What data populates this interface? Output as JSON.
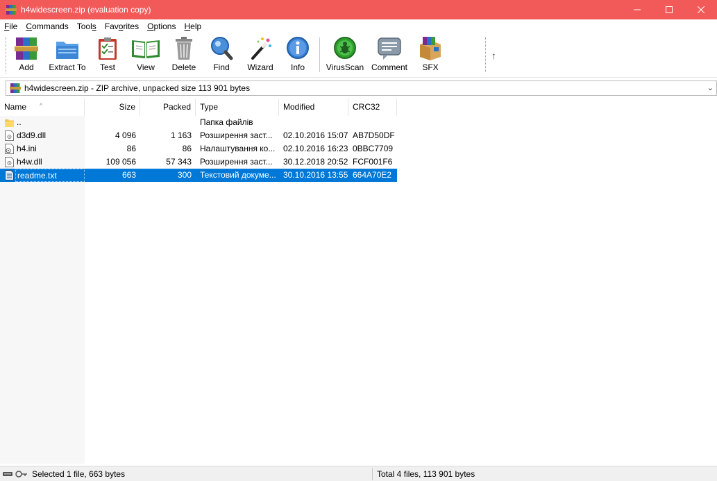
{
  "window": {
    "title": "h4widescreen.zip (evaluation copy)",
    "controls": {
      "minimize": "—",
      "maximize": "☐",
      "close": "✕"
    }
  },
  "menu": [
    {
      "label": "File",
      "u": "F",
      "rest": "ile"
    },
    {
      "label": "Commands",
      "u": "C",
      "rest": "ommands"
    },
    {
      "label": "Tools",
      "pre": "Tool",
      "u": "s"
    },
    {
      "label": "Favorites",
      "pre": "Fav",
      "u": "o",
      "rest": "rites"
    },
    {
      "label": "Options",
      "u": "O",
      "rest": "ptions"
    },
    {
      "label": "Help",
      "u": "H",
      "rest": "elp"
    }
  ],
  "toolbar": {
    "add": "Add",
    "extract": "Extract To",
    "test": "Test",
    "view": "View",
    "delete": "Delete",
    "find": "Find",
    "wizard": "Wizard",
    "info": "Info",
    "virusscan": "VirusScan",
    "comment": "Comment",
    "sfx": "SFX",
    "up_arrow": "↑"
  },
  "address": {
    "text": "h4widescreen.zip - ZIP archive, unpacked size 113 901 bytes",
    "dropdown": "⌄"
  },
  "columns": {
    "name": "Name",
    "size": "Size",
    "packed": "Packed",
    "type": "Type",
    "modified": "Modified",
    "crc": "CRC32",
    "sort_arrow": "^"
  },
  "files": [
    {
      "name": "..",
      "size": "",
      "packed": "",
      "type": "Папка файлів",
      "modified": "",
      "crc": "",
      "icon": "folder-icon"
    },
    {
      "name": "d3d9.dll",
      "size": "4 096",
      "packed": "1 163",
      "type": "Розширення заст...",
      "modified": "02.10.2016 15:07",
      "crc": "AB7D50DF",
      "icon": "dll-file-icon"
    },
    {
      "name": "h4.ini",
      "size": "86",
      "packed": "86",
      "type": "Налаштування ко...",
      "modified": "02.10.2016 16:23",
      "crc": "0BBC7709",
      "icon": "ini-file-icon"
    },
    {
      "name": "h4w.dll",
      "size": "109 056",
      "packed": "57 343",
      "type": "Розширення заст...",
      "modified": "30.12.2018 20:52",
      "crc": "FCF001F6",
      "icon": "dll-file-icon"
    },
    {
      "name": "readme.txt",
      "size": "663",
      "packed": "300",
      "type": "Текстовий докуме...",
      "modified": "30.10.2016 13:55",
      "crc": "664A70E2",
      "icon": "text-file-icon",
      "selected": true
    }
  ],
  "status": {
    "left": "Selected 1 file, 663 bytes",
    "right": "Total 4 files, 113 901 bytes"
  },
  "colors": {
    "titlebar": "#f25a5a",
    "selection": "#0078d7"
  }
}
